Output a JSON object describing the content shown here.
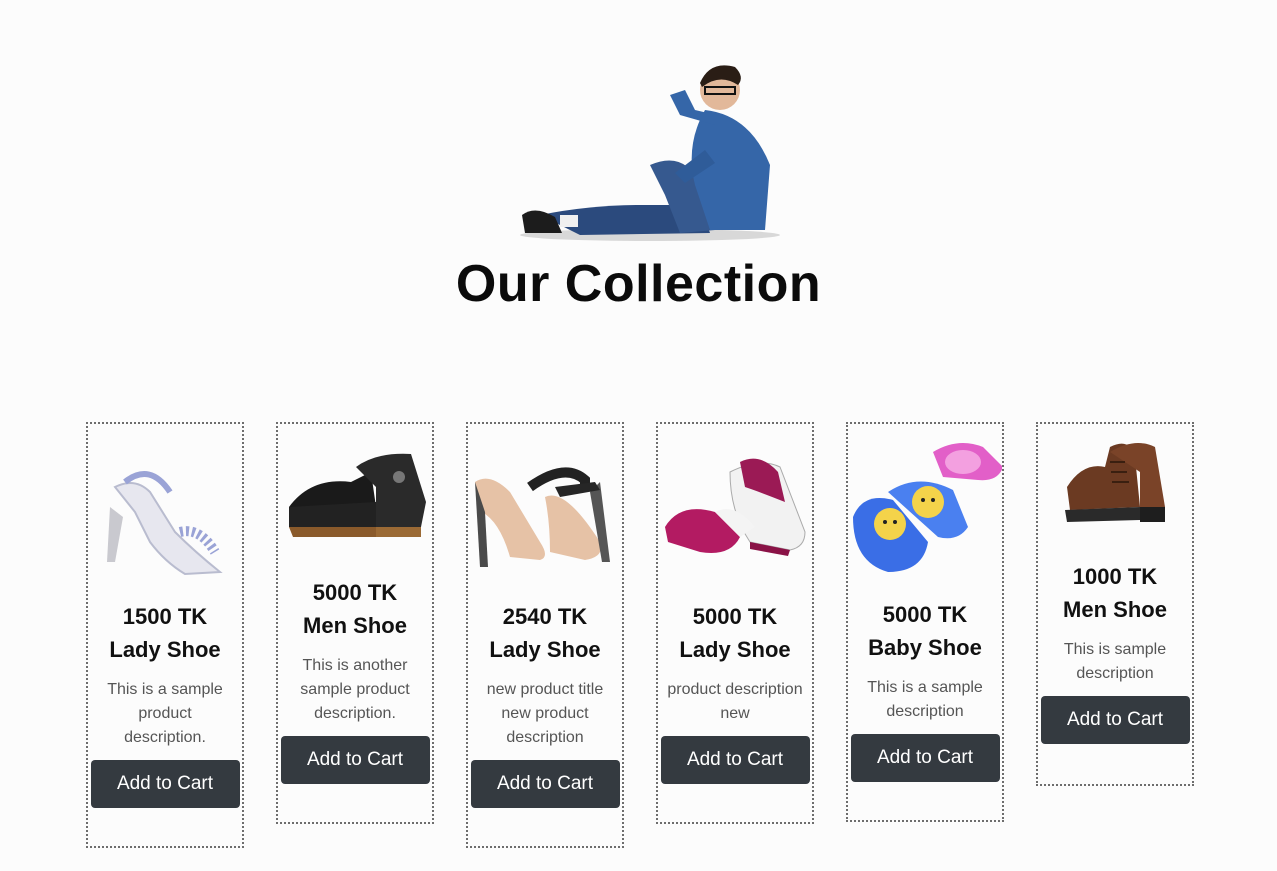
{
  "page": {
    "title": "Our Collection"
  },
  "products": [
    {
      "price": "1500 TK",
      "name": "Lady Shoe",
      "description": "This is a sample product description.",
      "button": "Add to Cart",
      "icon": "lady-sandal-icon"
    },
    {
      "price": "5000 TK",
      "name": "Men Shoe",
      "description": "This is another sample product description.",
      "button": "Add to Cart",
      "icon": "men-boot-icon"
    },
    {
      "price": "2540 TK",
      "name": "Lady Shoe",
      "description": "new product title new product description",
      "button": "Add to Cart",
      "icon": "high-heel-icon"
    },
    {
      "price": "5000 TK",
      "name": "Lady Shoe",
      "description": "product description new",
      "button": "Add to Cart",
      "icon": "sneaker-icon"
    },
    {
      "price": "5000 TK",
      "name": "Baby Shoe",
      "description": "This is a sample description",
      "button": "Add to Cart",
      "icon": "baby-slipper-icon"
    },
    {
      "price": "1000 TK",
      "name": "Men Shoe",
      "description": "This is sample description",
      "button": "Add to Cart",
      "icon": "brown-boot-icon"
    }
  ],
  "colors": {
    "button_bg": "#343a40",
    "button_text": "#ffffff",
    "border": "#6d6d6d"
  }
}
